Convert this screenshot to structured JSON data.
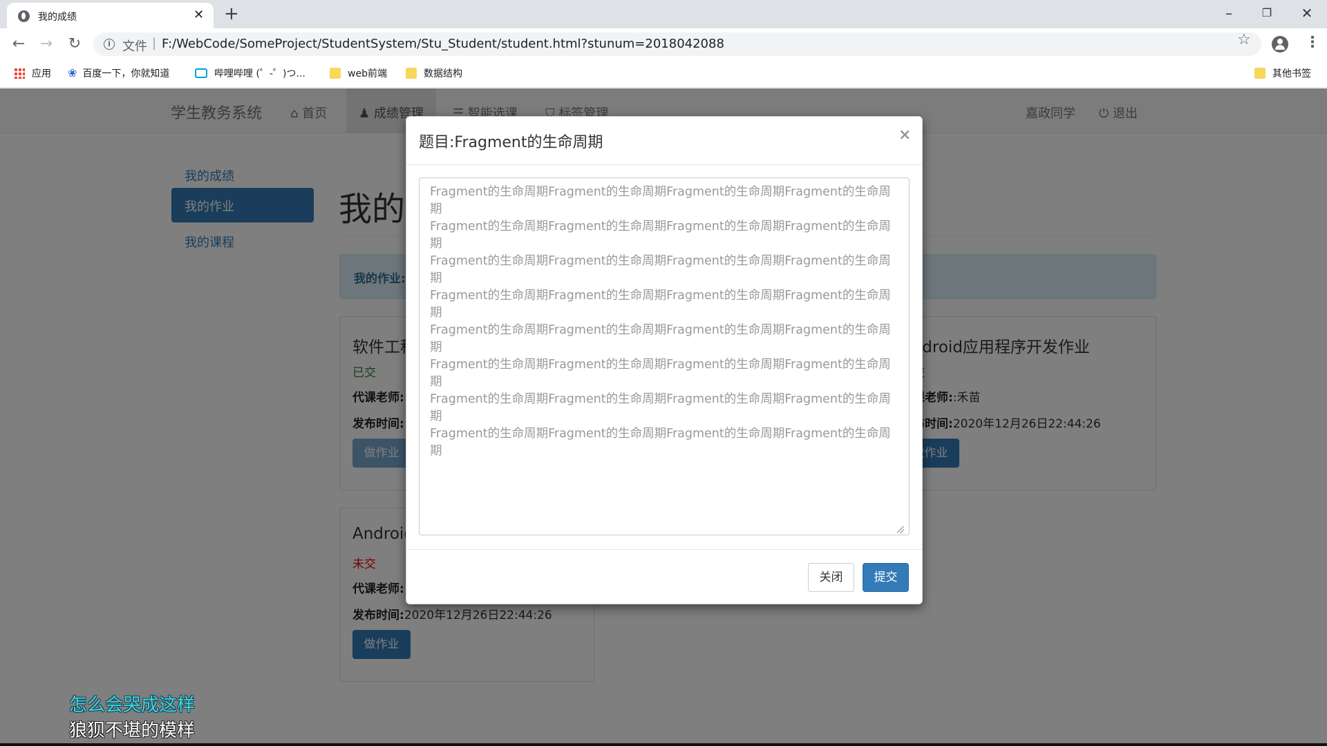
{
  "browser": {
    "tab_title": "我的成绩",
    "url_scheme": "文件",
    "url": "F:/WebCode/SomeProject/StudentSystem/Stu_Student/student.html?stunum=2018042088",
    "bookmarks": [
      "应用",
      "百度一下，你就知道",
      "哔哩哔哩 (゜-゜)つ...",
      "web前端",
      "数据结构"
    ],
    "other_bookmarks": "其他书签"
  },
  "navbar": {
    "brand": "学生教务系统",
    "items": [
      "首页",
      "成绩管理",
      "智能选课",
      "标签管理"
    ],
    "user": "嘉政同学",
    "logout": "退出"
  },
  "sidebar": {
    "items": [
      "我的成绩",
      "我的作业",
      "我的课程"
    ]
  },
  "main": {
    "header": "我的作业",
    "alert_label": "我的作业:"
  },
  "cards": [
    {
      "title": "软件工程",
      "status": "已交",
      "teacher_label": "代课老师:",
      "date_label": "发布时间:",
      "button": "做作业"
    },
    {
      "title": "Android应用程序开发作业",
      "status": "未交",
      "teacher_label": "代课老师:",
      "teacher": ":禾苗",
      "date_label": "发布时间:",
      "date": "2020年12月26日22:44:26",
      "button": "做作业"
    },
    {
      "title": "Android",
      "status": "未交",
      "teacher_label": "代课老师:",
      "date_label": "发布时间:",
      "date": "2020年12月26日22:44:26",
      "button": "做作业"
    }
  ],
  "modal": {
    "title": "题目:Fragment的生命周期",
    "close_symbol": "×",
    "content": "Fragment的生命周期Fragment的生命周期Fragment的生命周期Fragment的生命周期\nFragment的生命周期Fragment的生命周期Fragment的生命周期Fragment的生命周期\nFragment的生命周期Fragment的生命周期Fragment的生命周期Fragment的生命周期\nFragment的生命周期Fragment的生命周期Fragment的生命周期Fragment的生命周期\nFragment的生命周期Fragment的生命周期Fragment的生命周期Fragment的生命周期\nFragment的生命周期Fragment的生命周期Fragment的生命周期Fragment的生命周期\nFragment的生命周期Fragment的生命周期Fragment的生命周期Fragment的生命周期\nFragment的生命周期Fragment的生命周期Fragment的生命周期Fragment的生命周期",
    "close_button": "关闭",
    "submit_button": "提交"
  },
  "subtitles": {
    "line1": "怎么会哭成这样",
    "line2": "狼狈不堪的模样"
  },
  "colors": {
    "primary": "#337ab7",
    "status_done": "#3c763d",
    "status_pending": "#e60000"
  }
}
